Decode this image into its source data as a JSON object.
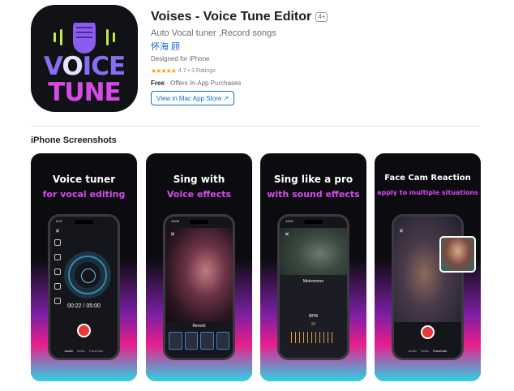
{
  "app": {
    "title": "Voises - Voice Tune Editor",
    "age_rating": "4+",
    "subtitle": "Auto Vocal tuner ,Record songs",
    "developer": "怀海 顾",
    "designed_for": "Designed for iPhone",
    "rating": "4.7",
    "ratings_count": "3 Ratings",
    "price": "Free",
    "in_app": "Offers In-App Purchases",
    "store_button": "View in Mac App Store ↗",
    "icon_text_1a": "V",
    "icon_text_1b": "O",
    "icon_text_1c": "ICE",
    "icon_text_2": "TUNE"
  },
  "section": {
    "title": "iPhone Screenshots"
  },
  "screenshots": [
    {
      "headline": "Voice tuner",
      "subline": "for vocal editing",
      "timer": "00:22 / 05:00",
      "time": "9:27",
      "tabs": [
        "Audio",
        "Video",
        "FaceCam"
      ]
    },
    {
      "headline": "Sing with",
      "subline": "Voice effects",
      "time": "13:09",
      "panel": "Reverb"
    },
    {
      "headline": "Sing like a pro",
      "subline": "with sound effects",
      "time": "13:07",
      "panel": "Metronome",
      "bpm": "BPM",
      "bpm_value": "90"
    },
    {
      "headline": "Face Cam Reaction",
      "subline": "apply to multiple situations",
      "tabs": [
        "Audio",
        "Video",
        "FaceCam"
      ]
    }
  ],
  "colors": {
    "accent": "#0a6dd6",
    "star": "#ff9f0a",
    "subline": "#d64af0"
  }
}
